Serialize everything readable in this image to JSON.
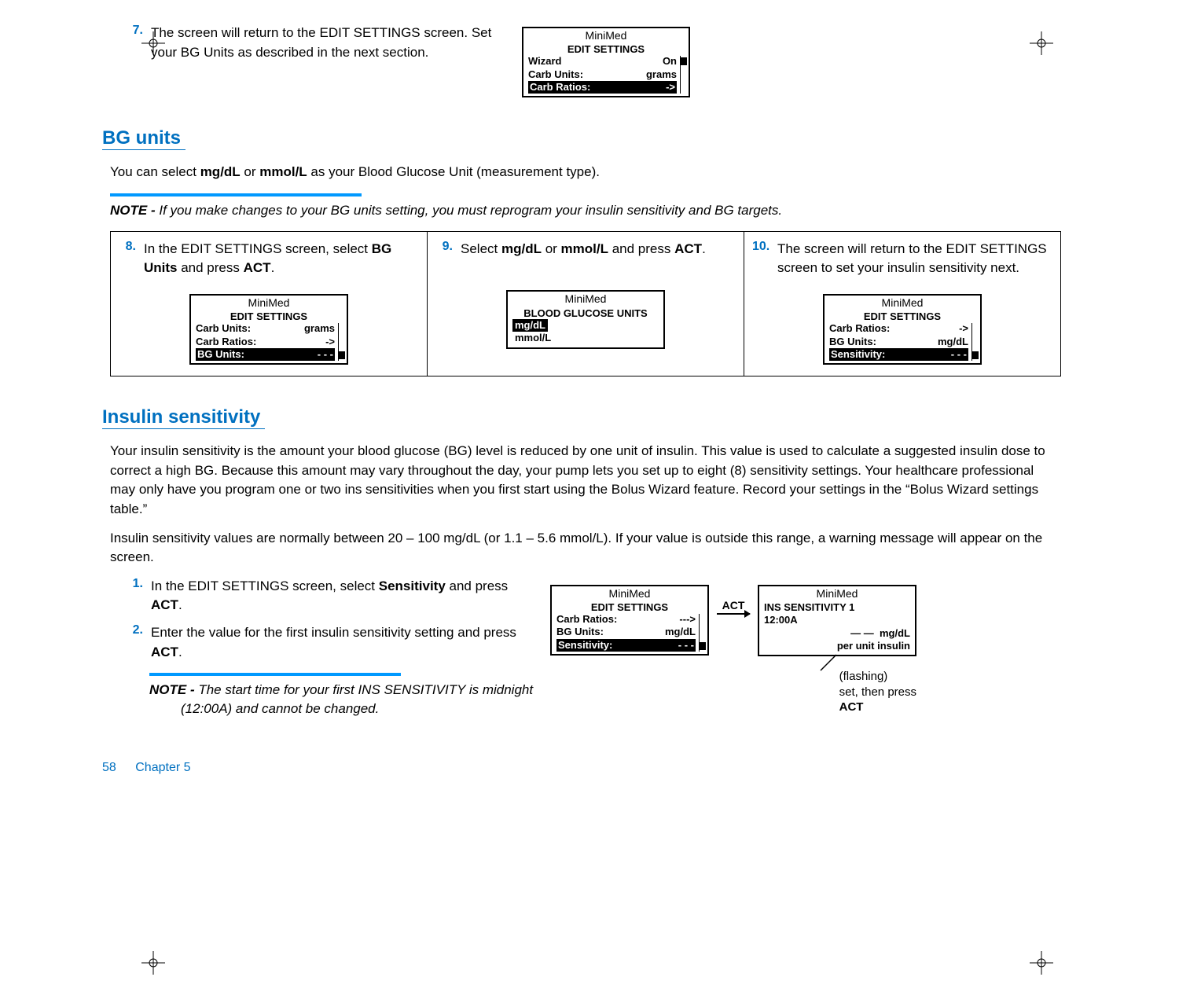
{
  "step7": {
    "num": "7.",
    "text_a": "The screen will return to the ",
    "text_b": " screen. Set your BG Units as described in the next section.",
    "sf": "EDIT SETTINGS"
  },
  "dev7": {
    "brand": "MiniMed",
    "title": "EDIT SETTINGS",
    "l1a": "Wizard",
    "l1b": "On",
    "l2a": "Carb Units:",
    "l2b": "grams",
    "l3a": "Carb Ratios:",
    "l3b": "->"
  },
  "h_bg": "BG units",
  "bg_intro_a": "You can select ",
  "bg_intro_b": " or ",
  "bg_intro_c": " as your Blood Glucose Unit (measurement type).",
  "bg_mg": "mg/dL",
  "bg_mmol": "mmol/L",
  "note1_label": "NOTE - ",
  "note1_text": "If you make changes to your BG units setting, you must reprogram your insulin sensitivity and BG targets.",
  "step8": {
    "num": "8.",
    "a": "In the ",
    "sf": "EDIT SETTINGS",
    "b": " screen, select ",
    "bold": "BG Units",
    "c": " and press ",
    "act": "ACT",
    "d": "."
  },
  "dev8": {
    "brand": "MiniMed",
    "title": "EDIT SETTINGS",
    "l1a": "Carb Units:",
    "l1b": "grams",
    "l2a": "Carb Ratios:",
    "l2b": "->",
    "l3a": "BG Units:",
    "l3b": "- - -"
  },
  "step9": {
    "num": "9.",
    "a": "Select ",
    "b1": "mg/dL",
    "or": " or ",
    "b2": "mmol/L",
    "c": " and press ",
    "act": "ACT",
    "d": "."
  },
  "dev9": {
    "brand": "MiniMed",
    "title": "BLOOD GLUCOSE UNITS",
    "opt1": "mg/dL",
    "opt2": "mmol/L"
  },
  "step10": {
    "num": "10.",
    "a": "The screen will return to the ",
    "sf": "EDIT SETTINGS",
    "b": " screen to set your insulin sensitivity next."
  },
  "dev10": {
    "brand": "MiniMed",
    "title": "EDIT SETTINGS",
    "l1a": "Carb Ratios:",
    "l1b": "->",
    "l2a": "BG Units:",
    "l2b": "mg/dL",
    "l3a": "Sensitivity:",
    "l3b": "- - -"
  },
  "h_ins": "Insulin sensitivity",
  "ins_p1": "Your insulin sensitivity is the amount your blood glucose (BG) level is reduced by one unit of insulin. This value is used to calculate a suggested insulin dose to correct a high BG. Because this amount may vary throughout the day, your pump lets you set up to eight (8) sensitivity settings. Your healthcare professional may only have you program one or two ins sensitivities when you first start using the Bolus Wizard feature. Record your settings in the “Bolus Wizard settings table.”",
  "ins_p2": "Insulin sensitivity values are normally between 20 – 100 mg/dL (or 1.1 – 5.6 mmol/L). If your value is outside this range, a warning message will appear on the screen.",
  "step_i1": {
    "num": "1.",
    "a": "In the ",
    "sf": "EDIT SETTINGS",
    "b": " screen, select ",
    "bold": "Sensitivity",
    "c": " and press ",
    "act": "ACT",
    "d": "."
  },
  "step_i2": {
    "num": "2.",
    "a": "Enter the value for the first insulin sensitivity setting and press ",
    "act": "ACT",
    "b": "."
  },
  "dev_i1": {
    "brand": "MiniMed",
    "title": "EDIT SETTINGS",
    "l1a": "Carb Ratios:",
    "l1b": "--->",
    "l2a": "BG Units:",
    "l2b": "mg/dL",
    "l3a": "Sensitivity:",
    "l3b": "- - -"
  },
  "act_arrow": "ACT",
  "dev_i2": {
    "brand": "MiniMed",
    "title": "INS SENSITIVITY 1",
    "time": "12:00A",
    "dash": "—  —",
    "unit1": "mg/dL",
    "unit2": "per unit insulin"
  },
  "flash": {
    "l1": "(flashing)",
    "l2": "set, then press",
    "l3": "ACT"
  },
  "note2_label": "NOTE - ",
  "note2_text": "The start time for your first INS SENSITIVITY is midnight (12:00A) and cannot be changed.",
  "footer_page": "58",
  "footer_chap": "Chapter 5"
}
